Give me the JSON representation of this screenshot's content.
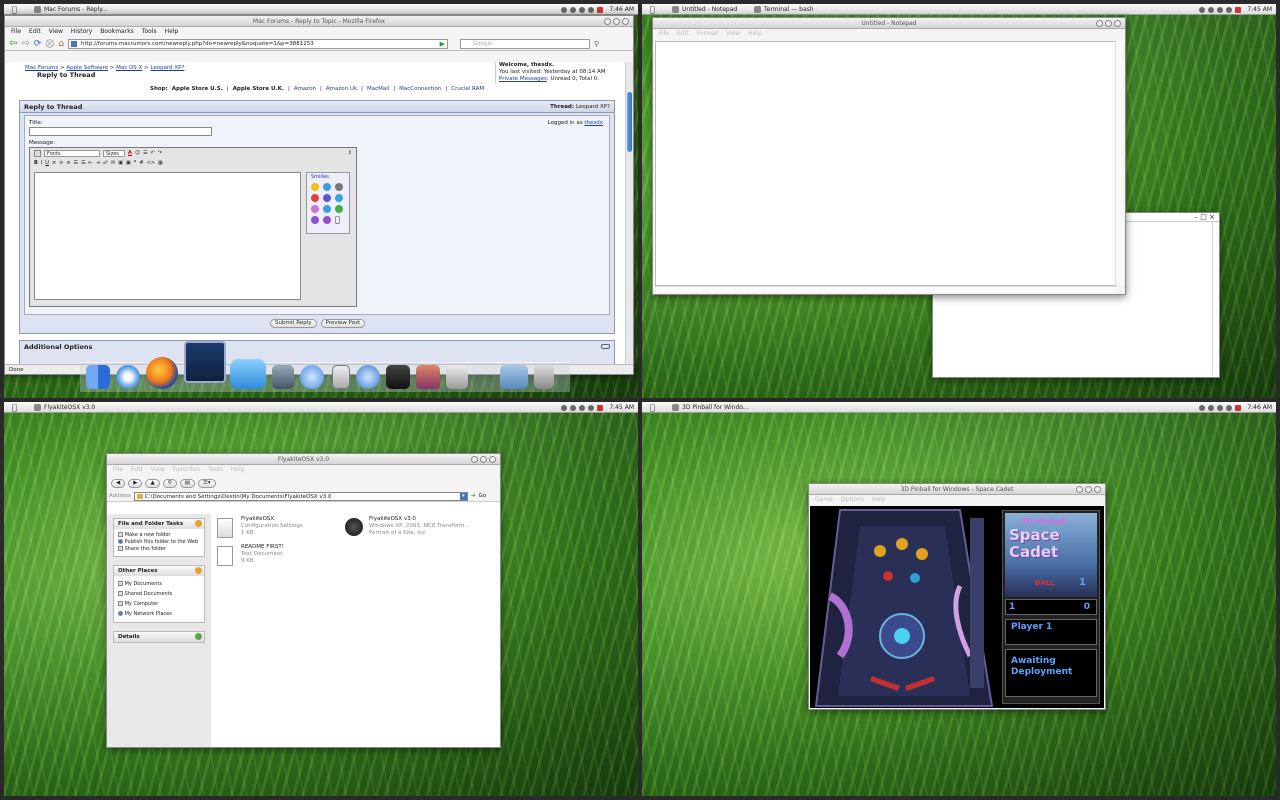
{
  "taskbar_tasks": {
    "q1": [
      "Mac Forums - Reply..."
    ],
    "q2": [
      "Untitled - Notepad",
      "Terminal — bash"
    ],
    "q3": [
      "FlyakiteOSX v3.0"
    ],
    "q4": [
      "3D Pinball for Windo..."
    ]
  },
  "clocks": {
    "q1": "7:46 AM",
    "q2": "7:45 AM",
    "q3": "7:45 AM",
    "q4": "7:46 AM"
  },
  "firefox": {
    "title": "Mac Forums - Reply to Topic - Mozilla Firefox",
    "menu": [
      "File",
      "Edit",
      "View",
      "History",
      "Bookmarks",
      "Tools",
      "Help"
    ],
    "url": "http://forums.macrumors.com/newreply.php?do=newreply&noquote=1&p=3881253",
    "search_placeholder": "Google",
    "breadcrumb": [
      "Mac Forums",
      "Apple Software",
      "Mac OS X",
      "Leopard XP?"
    ],
    "breadcrumb_current": "Reply to Thread",
    "welcome": "Welcome, thesdx.",
    "last_visited": "You last visited: Yesterday at 08:14 AM",
    "private_messages_link": "Private Messages",
    "private_messages_status": ": Unread 0, Total 0.",
    "shop_label": "Shop:",
    "shop_links": [
      "Apple Store U.S.",
      "Apple Store U.K.",
      "Amazon",
      "Amazon Uk",
      "MacMall",
      "MacConnection",
      "Crucial RAM"
    ],
    "panel_title": "Reply to Thread",
    "thread_label": "Thread:",
    "thread_name": "Leopard XP?",
    "title_label": "Title:",
    "logged_in_label": "Logged in as",
    "logged_in_user": "thesdx",
    "message_label": "Message:",
    "fonts_select": "Fonts",
    "sizes_select": "Sizes",
    "smilies_label": "Smilies",
    "submit_label": "Submit Reply",
    "preview_label": "Preview Post",
    "additional_options": "Additional Options",
    "status": "Done"
  },
  "notepad": {
    "title": "Untitled - Notepad",
    "menu": [
      "File",
      "Edit",
      "Format",
      "View",
      "Help"
    ]
  },
  "explorer": {
    "title": "FlyakiteOSX v3.0",
    "menu": [
      "File",
      "Edit",
      "View",
      "Favorites",
      "Tools",
      "Help"
    ],
    "address_label": "Address",
    "address": "C:\\Documents and Settings\\Destin\\My Documents\\FlyakiteOSX v3.0",
    "go_label": "Go",
    "tasks_title": "File and Folder Tasks",
    "tasks": [
      "Make a new folder",
      "Publish this folder to the Web",
      "Share this folder"
    ],
    "places_title": "Other Places",
    "places": [
      "My Documents",
      "Shared Documents",
      "My Computer",
      "My Network Places"
    ],
    "details_title": "Details",
    "files": [
      {
        "name": "FlyakiteOSX",
        "line1": "Configuration Settings",
        "line2": "1 KB"
      },
      {
        "name": "FlyakiteOSX v3.0",
        "line1": "Windows XP, 2003, MCE Transform...",
        "line2": "Portrait of a Kite, Inc"
      },
      {
        "name": "README FIRST!",
        "line1": "Text Document",
        "line2": "9 KB"
      }
    ]
  },
  "pinball": {
    "title": "3D Pinball for Windows - Space Cadet",
    "menu": [
      "Game",
      "Options",
      "Help"
    ],
    "logo_top": "3D Pinball",
    "logo_main": "Space Cadet",
    "ball_label": "BALL",
    "ball_number": "1",
    "player_num": "1",
    "score": "0",
    "player_label": "Player 1",
    "status": "Awaiting Deployment"
  }
}
